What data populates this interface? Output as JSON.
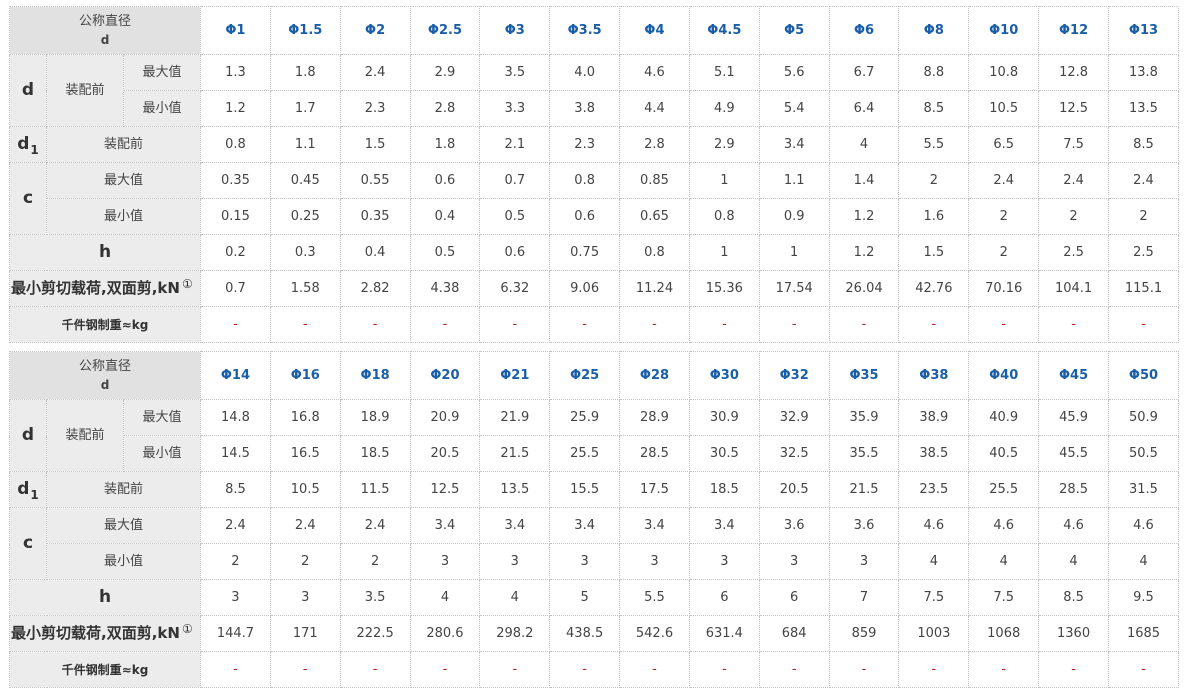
{
  "labels": {
    "nominal": "公称直径",
    "nominal_sub": "d",
    "d": "d",
    "before_assembly": "装配前",
    "max": "最大值",
    "min": "最小值",
    "d1_main": "d",
    "d1_sub": "1",
    "c": "c",
    "h": "h",
    "shear": "最小剪切载荷,双面剪,kN",
    "shear_note": "①",
    "weight": "千件钢制重≈kg"
  },
  "tables": [
    {
      "sizes": [
        "Φ1",
        "Φ1.5",
        "Φ2",
        "Φ2.5",
        "Φ3",
        "Φ3.5",
        "Φ4",
        "Φ4.5",
        "Φ5",
        "Φ6",
        "Φ8",
        "Φ10",
        "Φ12",
        "Φ13"
      ],
      "d_max": [
        "1.3",
        "1.8",
        "2.4",
        "2.9",
        "3.5",
        "4.0",
        "4.6",
        "5.1",
        "5.6",
        "6.7",
        "8.8",
        "10.8",
        "12.8",
        "13.8"
      ],
      "d_min": [
        "1.2",
        "1.7",
        "2.3",
        "2.8",
        "3.3",
        "3.8",
        "4.4",
        "4.9",
        "5.4",
        "6.4",
        "8.5",
        "10.5",
        "12.5",
        "13.5"
      ],
      "d1": [
        "0.8",
        "1.1",
        "1.5",
        "1.8",
        "2.1",
        "2.3",
        "2.8",
        "2.9",
        "3.4",
        "4",
        "5.5",
        "6.5",
        "7.5",
        "8.5"
      ],
      "c_max": [
        "0.35",
        "0.45",
        "0.55",
        "0.6",
        "0.7",
        "0.8",
        "0.85",
        "1",
        "1.1",
        "1.4",
        "2",
        "2.4",
        "2.4",
        "2.4"
      ],
      "c_min": [
        "0.15",
        "0.25",
        "0.35",
        "0.4",
        "0.5",
        "0.6",
        "0.65",
        "0.8",
        "0.9",
        "1.2",
        "1.6",
        "2",
        "2",
        "2"
      ],
      "h": [
        "0.2",
        "0.3",
        "0.4",
        "0.5",
        "0.6",
        "0.75",
        "0.8",
        "1",
        "1",
        "1.2",
        "1.5",
        "2",
        "2.5",
        "2.5"
      ],
      "shear": [
        "0.7",
        "1.58",
        "2.82",
        "4.38",
        "6.32",
        "9.06",
        "11.24",
        "15.36",
        "17.54",
        "26.04",
        "42.76",
        "70.16",
        "104.1",
        "115.1"
      ],
      "weight": [
        "-",
        "-",
        "-",
        "-",
        "-",
        "-",
        "-",
        "-",
        "-",
        "-",
        "-",
        "-",
        "-",
        "-"
      ]
    },
    {
      "sizes": [
        "Φ14",
        "Φ16",
        "Φ18",
        "Φ20",
        "Φ21",
        "Φ25",
        "Φ28",
        "Φ30",
        "Φ32",
        "Φ35",
        "Φ38",
        "Φ40",
        "Φ45",
        "Φ50"
      ],
      "d_max": [
        "14.8",
        "16.8",
        "18.9",
        "20.9",
        "21.9",
        "25.9",
        "28.9",
        "30.9",
        "32.9",
        "35.9",
        "38.9",
        "40.9",
        "45.9",
        "50.9"
      ],
      "d_min": [
        "14.5",
        "16.5",
        "18.5",
        "20.5",
        "21.5",
        "25.5",
        "28.5",
        "30.5",
        "32.5",
        "35.5",
        "38.5",
        "40.5",
        "45.5",
        "50.5"
      ],
      "d1": [
        "8.5",
        "10.5",
        "11.5",
        "12.5",
        "13.5",
        "15.5",
        "17.5",
        "18.5",
        "20.5",
        "21.5",
        "23.5",
        "25.5",
        "28.5",
        "31.5"
      ],
      "c_max": [
        "2.4",
        "2.4",
        "2.4",
        "3.4",
        "3.4",
        "3.4",
        "3.4",
        "3.4",
        "3.6",
        "3.6",
        "4.6",
        "4.6",
        "4.6",
        "4.6"
      ],
      "c_min": [
        "2",
        "2",
        "2",
        "3",
        "3",
        "3",
        "3",
        "3",
        "3",
        "3",
        "4",
        "4",
        "4",
        "4"
      ],
      "h": [
        "3",
        "3",
        "3.5",
        "4",
        "4",
        "5",
        "5.5",
        "6",
        "6",
        "7",
        "7.5",
        "7.5",
        "8.5",
        "9.5"
      ],
      "shear": [
        "144.7",
        "171",
        "222.5",
        "280.6",
        "298.2",
        "438.5",
        "542.6",
        "631.4",
        "684",
        "859",
        "1003",
        "1068",
        "1360",
        "1685"
      ],
      "weight": [
        "-",
        "-",
        "-",
        "-",
        "-",
        "-",
        "-",
        "-",
        "-",
        "-",
        "-",
        "-",
        "-",
        "-"
      ]
    }
  ]
}
